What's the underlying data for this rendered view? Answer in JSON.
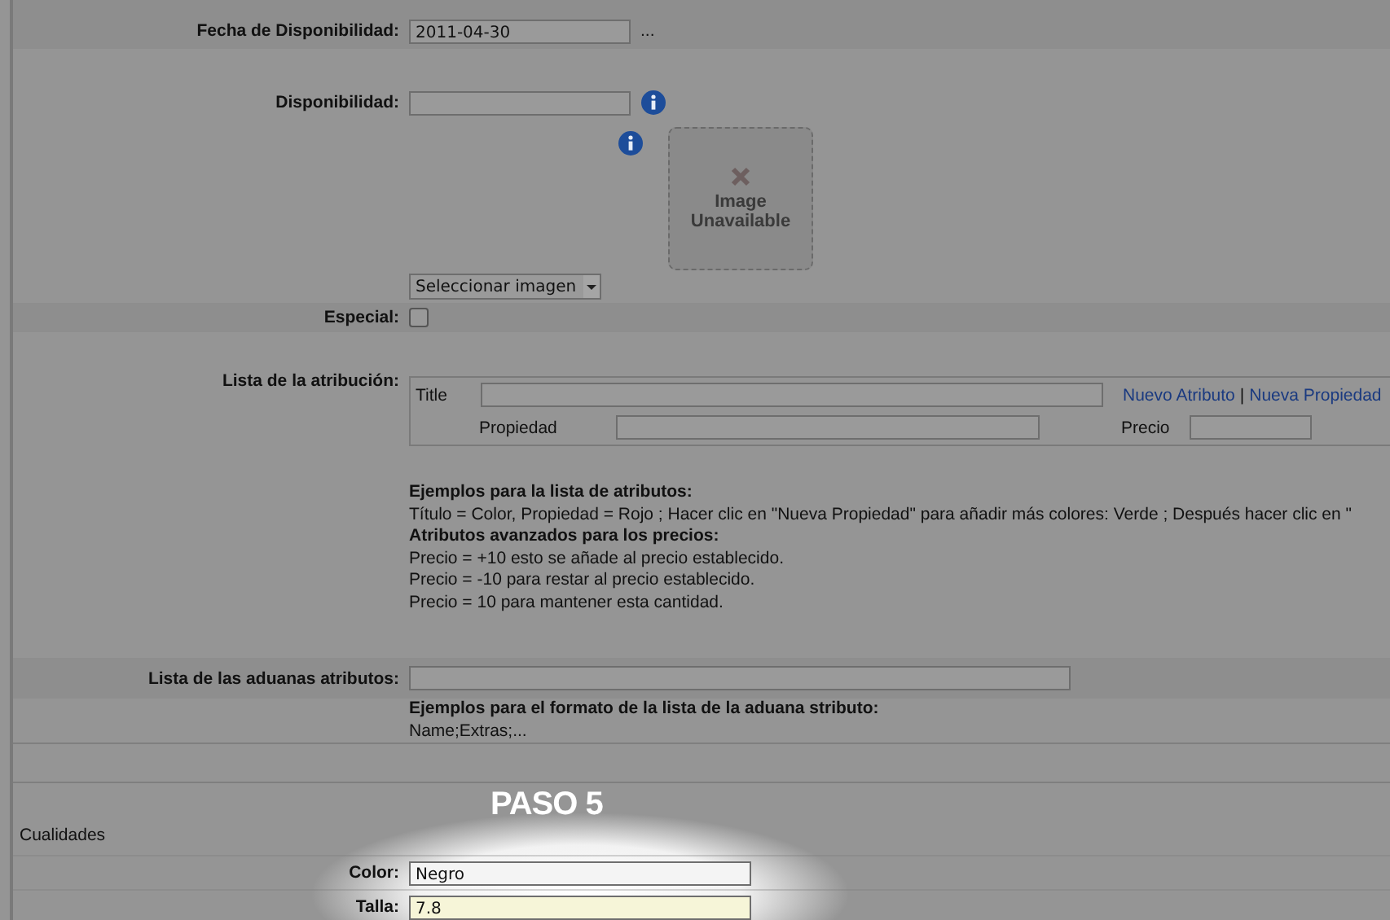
{
  "fields_top": [
    {
      "label": "Fecha de Disponibilidad:",
      "value": "2011-04-30",
      "button": "..."
    }
  ],
  "availability": {
    "label": "Disponibilidad:"
  },
  "image": {
    "placeholder_text": "Image Unavailable",
    "select": "Seleccionar imagen"
  },
  "special": {
    "label": "Especial:",
    "checked": false
  },
  "attributes": {
    "label": "Lista de la atribución:",
    "title_label": "Title",
    "links": [
      "Nuevo Atributo",
      "Nueva Propiedad"
    ],
    "link_separator": "|",
    "property_label": "Propiedad",
    "price_label": "Precio",
    "examples": [
      "**Ejemplos para la lista de atributos:**",
      "Título = Color, Propiedad = Rojo ; Hacer clic en \"Nueva Propiedad\" para añadir más colores: Verde ; Después hacer clic en \"",
      "**Atributos avanzados para los precios:**",
      "Precio = +10 esto se añade al precio establecido.",
      "Precio = -10 para restar al precio establecido.",
      "Precio = 10 para mantener esta cantidad."
    ]
  },
  "custom_attributes": {
    "label": "Lista de las aduanas atributos:",
    "examples": [
      "**Ejemplos para el formato de la lista de la aduana stributo:**",
      "Name;Extras;..."
    ]
  },
  "step_badge": "PASO 5",
  "qualities": {
    "title": "Cualidades",
    "fields": [
      {
        "label": "Color:",
        "value": "Negro",
        "highlighted": false
      },
      {
        "label": "Talla:",
        "value": "7.8",
        "highlighted": true
      }
    ]
  }
}
